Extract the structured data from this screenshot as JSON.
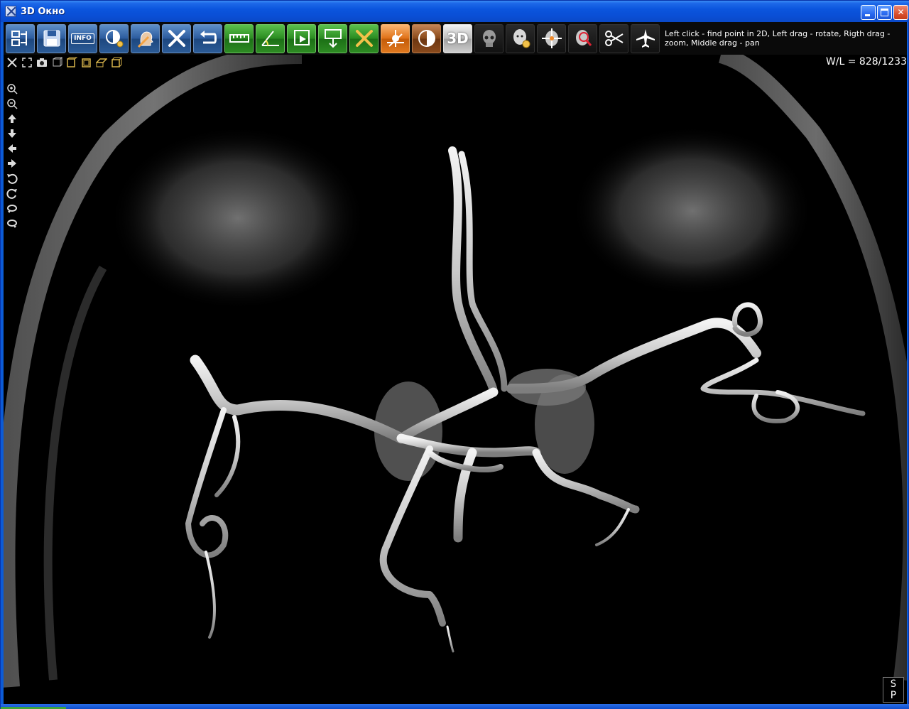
{
  "window": {
    "title": "3D Окно"
  },
  "toolbar": {
    "buttons": [
      {
        "name": "series-layout-button",
        "icon": "series-layout-icon",
        "style": "blue"
      },
      {
        "name": "save-button",
        "icon": "floppy-disk-icon",
        "style": "blue"
      },
      {
        "name": "info-button",
        "icon": "info-icon",
        "label": "INFO",
        "style": "blue"
      },
      {
        "name": "display-settings-button",
        "icon": "contrast-gear-icon",
        "style": "blue"
      },
      {
        "name": "head-render-button",
        "icon": "head-profile-icon",
        "style": "blue"
      },
      {
        "name": "tools-button",
        "icon": "wrench-screwdriver-icon",
        "style": "blue"
      },
      {
        "name": "undo-button",
        "icon": "undo-arrow-icon",
        "style": "blue"
      },
      {
        "name": "measure-distance-button",
        "icon": "ruler-icon",
        "style": "green"
      },
      {
        "name": "measure-angle-button",
        "icon": "angle-icon",
        "style": "green"
      },
      {
        "name": "annotation-button",
        "icon": "annotation-play-icon",
        "style": "green"
      },
      {
        "name": "text-marker-button",
        "icon": "text-marker-icon",
        "style": "green"
      },
      {
        "name": "delete-button",
        "icon": "close-x-icon",
        "style": "green"
      },
      {
        "name": "volume-render-button",
        "icon": "volume-render-icon",
        "style": "orange"
      },
      {
        "name": "window-level-button",
        "icon": "half-circle-contrast-icon",
        "style": "brown"
      },
      {
        "name": "3d-mode-button",
        "icon": "3d-icon",
        "label": "3D",
        "style": "gray"
      },
      {
        "name": "skull-view-button",
        "icon": "skull-icon",
        "style": "dark"
      },
      {
        "name": "head-settings-button",
        "icon": "head-gear-icon",
        "style": "dark"
      },
      {
        "name": "crosshair-button",
        "icon": "crosshair-icon",
        "style": "dark"
      },
      {
        "name": "magnifier-button",
        "icon": "magnifier-head-icon",
        "style": "dark"
      },
      {
        "name": "cut-button",
        "icon": "scissors-icon",
        "style": "dark"
      },
      {
        "name": "fly-through-button",
        "icon": "airplane-icon",
        "style": "dark"
      }
    ],
    "hint": "Left click - find point in 2D, Left drag - rotate, Rigth drag - zoom, Middle drag - pan"
  },
  "viewport": {
    "window_level": "W/L = 828/1233",
    "top_icons": [
      "cut-tool-icon",
      "fullscreen-icon",
      "camera-icon",
      "clip-box-icon",
      "view-left-icon",
      "view-front-icon",
      "view-top-icon",
      "view-3d-box-icon"
    ],
    "left_icons": [
      "zoom-in-icon",
      "zoom-out-icon",
      "arrow-up-icon",
      "arrow-down-icon",
      "arrow-left-icon",
      "arrow-right-icon",
      "rotate-ccw-icon",
      "rotate-cw-icon",
      "spin-left-icon",
      "spin-right-icon"
    ],
    "badge_top": "S",
    "badge_bottom": "P"
  },
  "colors": {
    "titlebar": "#0a4fd6",
    "toolbar_bg": "#0a0a0a",
    "viewport_bg": "#000000",
    "vessel": "#d4d4d4"
  }
}
